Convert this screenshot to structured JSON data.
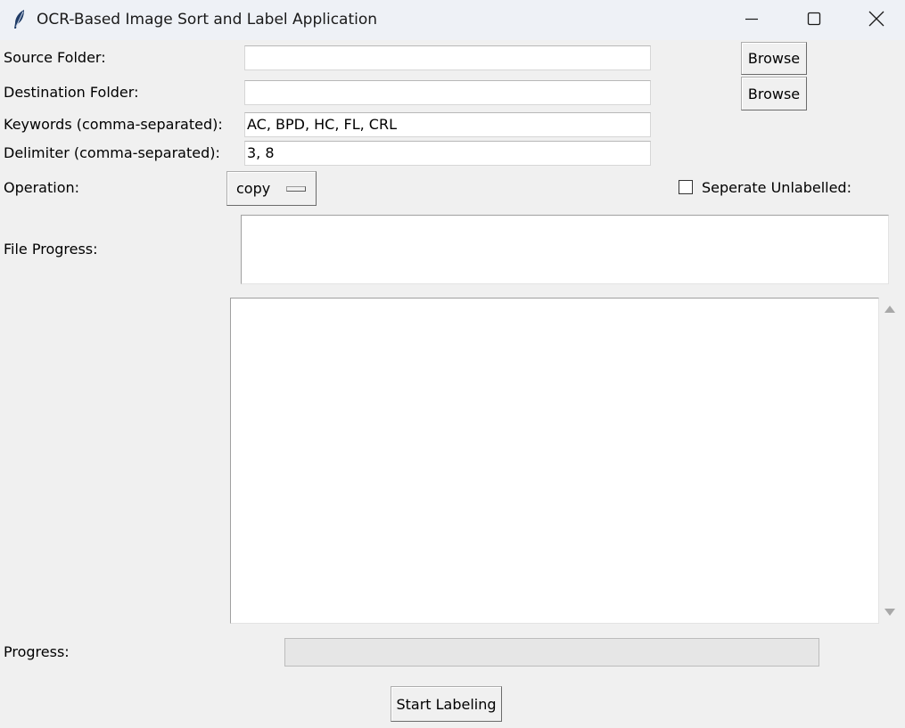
{
  "window": {
    "title": "OCR-Based Image Sort and Label Application"
  },
  "form": {
    "source_folder": {
      "label": "Source Folder:",
      "value": "",
      "browse_label": "Browse"
    },
    "destination_folder": {
      "label": "Destination Folder:",
      "value": "",
      "browse_label": "Browse"
    },
    "keywords": {
      "label": "Keywords (comma-separated):",
      "value": "AC, BPD, HC, FL, CRL"
    },
    "delimiter": {
      "label": "Delimiter (comma-separated):",
      "value": "3, 8"
    },
    "operation": {
      "label": "Operation:",
      "selected": "copy"
    },
    "separate_unlabelled": {
      "label": "Seperate Unlabelled:",
      "checked": false
    },
    "file_progress": {
      "label": "File Progress:",
      "text": ""
    },
    "log": {
      "text": ""
    },
    "progress": {
      "label": "Progress:",
      "value": 0
    },
    "start_button": "Start Labeling"
  },
  "colors": {
    "window_bg": "#f0f0f0",
    "titlebar_bg": "#eef1f6",
    "field_bg": "#ffffff"
  },
  "icons": {
    "app": "feather-icon",
    "minimize": "minimize-icon",
    "maximize": "maximize-icon",
    "close": "close-icon"
  }
}
